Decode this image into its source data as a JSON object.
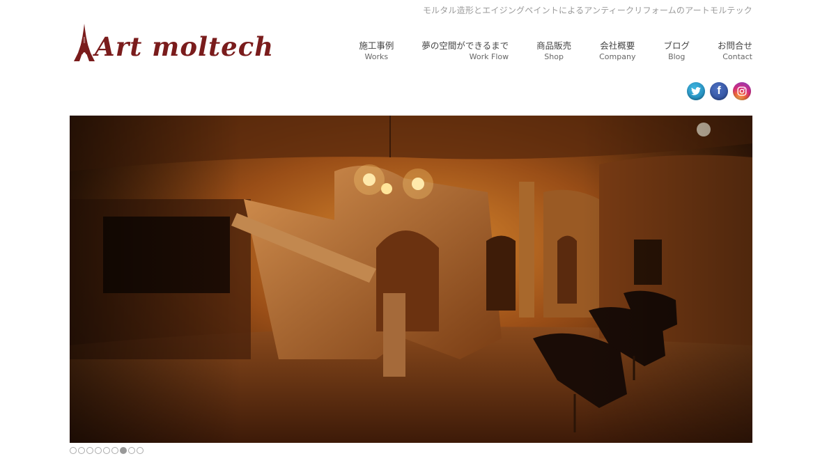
{
  "header": {
    "tagline": "モルタル造形とエイジングペイントによるアンティークリフォームのアートモルテック",
    "logo_text": "Art moltech",
    "logo_mark": "eiffel-tower-letter-A"
  },
  "nav": [
    {
      "jp": "施工事例",
      "en": "Works"
    },
    {
      "jp": "夢の空間ができるまで",
      "en": "Work Flow"
    },
    {
      "jp": "商品販売",
      "en": "Shop"
    },
    {
      "jp": "会社概要",
      "en": "Company"
    },
    {
      "jp": "ブログ",
      "en": "Blog"
    },
    {
      "jp": "お問合せ",
      "en": "Contact"
    }
  ],
  "social": [
    {
      "name": "twitter",
      "glyph": "🐦"
    },
    {
      "name": "facebook",
      "glyph": "f"
    },
    {
      "name": "instagram",
      "glyph": "◎"
    }
  ],
  "slider": {
    "total_slides": 9,
    "active_index": 6,
    "image": "salon-interior-stone-cave-with-chandelier-and-barber-chairs"
  },
  "colors": {
    "brand": "#7a1c1c",
    "tagline": "#9a9a9a",
    "dot_active": "#999999"
  }
}
